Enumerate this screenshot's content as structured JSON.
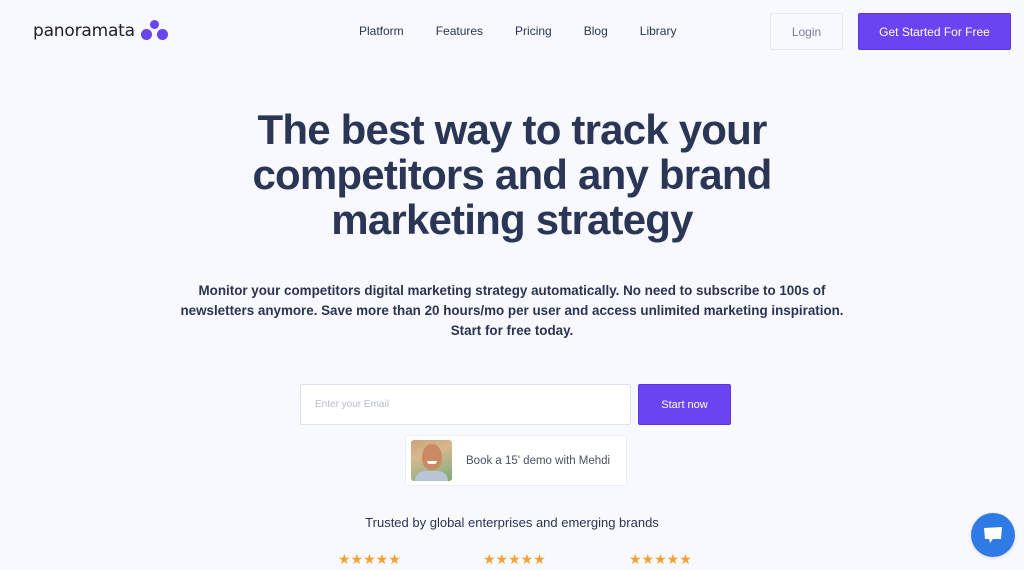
{
  "brand": {
    "name": "panoramata",
    "accent_color": "#6a44f0"
  },
  "nav": {
    "links": [
      {
        "label": "Platform"
      },
      {
        "label": "Features"
      },
      {
        "label": "Pricing"
      },
      {
        "label": "Blog"
      },
      {
        "label": "Library"
      }
    ],
    "login_label": "Login",
    "cta_label": "Get Started For Free"
  },
  "hero": {
    "title": "The best way to track your competitors and any brand marketing strategy",
    "subtitle": "Monitor your competitors digital marketing strategy automatically. No need to subscribe to 100s of newsletters anymore. Save more than 20 hours/mo per user and access unlimited marketing inspiration. Start for free today.",
    "email_placeholder": "Enter your Email",
    "email_value": "",
    "start_label": "Start now",
    "demo_label": "Book a 15' demo with Mehdi"
  },
  "trust": {
    "heading": "Trusted by global enterprises and emerging brands",
    "ratings": [
      {
        "stars": "★★★★★",
        "value": 5
      },
      {
        "stars": "★★★★★",
        "value": 5
      },
      {
        "stars": "★★★★★",
        "value": 5
      }
    ],
    "star_color": "#f4a134"
  },
  "chat": {
    "icon": "chat-bubble-icon",
    "color": "#2f7be6"
  }
}
